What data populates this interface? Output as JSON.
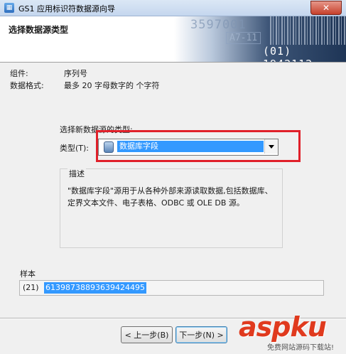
{
  "window": {
    "title": "GS1 应用标识符数据源向导",
    "app_icon": "gs1-wizard-icon",
    "close_label": "✕"
  },
  "header": {
    "title": "选择数据源类型",
    "banner_numbers": [
      "3597001",
      "A7-11"
    ],
    "banner_code": "(01) 1942112"
  },
  "info": {
    "component_label": "组件:",
    "component_value": "序列号",
    "format_label": "数据格式:",
    "format_value": "最多 20 字母数字的 个字符"
  },
  "source": {
    "prompt": "选择新数据源的类型:",
    "type_label": "类型(T):",
    "selected": "数据库字段",
    "icon": "database-icon",
    "highlight_color": "#e0202a"
  },
  "description": {
    "title": "描述",
    "text": "\"数据库字段\"源用于从各种外部来源读取数据,包括数据库、定界文本文件、电子表格、ODBC 或 OLE DB 源。"
  },
  "sample": {
    "label": "样本",
    "prefix": "(21)",
    "value": "6139873889363942449​5"
  },
  "buttons": {
    "back": "< 上一步(B)",
    "next": "下一步(N) >"
  },
  "watermark": {
    "brand": "aspku",
    "tagline": "免费网站源码下载站!"
  }
}
